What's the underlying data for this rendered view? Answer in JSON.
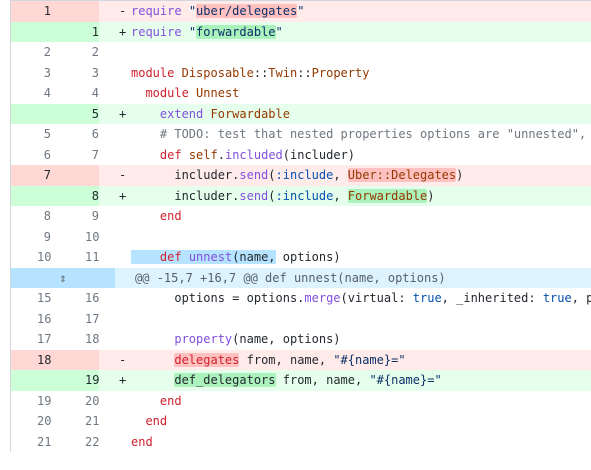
{
  "rows": [
    {
      "type": "del",
      "old": "1",
      "new": "",
      "mark": "-",
      "tokens": [
        [
          "fn",
          "require"
        ],
        [
          "",
          " "
        ],
        [
          "str",
          "\""
        ],
        [
          "hl-del str",
          "uber/delegates"
        ],
        [
          "str",
          "\""
        ]
      ]
    },
    {
      "type": "add",
      "old": "",
      "new": "1",
      "mark": "+",
      "tokens": [
        [
          "fn",
          "require"
        ],
        [
          "",
          " "
        ],
        [
          "str",
          "\""
        ],
        [
          "hl-add str",
          "forwardable"
        ],
        [
          "str",
          "\""
        ]
      ]
    },
    {
      "type": "ctx",
      "old": "2",
      "new": "2",
      "mark": "",
      "tokens": []
    },
    {
      "type": "ctx",
      "old": "3",
      "new": "3",
      "mark": "",
      "tokens": [
        [
          "kw",
          "module"
        ],
        [
          "",
          " "
        ],
        [
          "const",
          "Disposable"
        ],
        [
          "",
          "::"
        ],
        [
          "const",
          "Twin"
        ],
        [
          "",
          "::"
        ],
        [
          "const",
          "Property"
        ]
      ]
    },
    {
      "type": "ctx",
      "old": "4",
      "new": "4",
      "mark": "",
      "tokens": [
        [
          "",
          "  "
        ],
        [
          "kw",
          "module"
        ],
        [
          "",
          " "
        ],
        [
          "const",
          "Unnest"
        ]
      ]
    },
    {
      "type": "add",
      "old": "",
      "new": "5",
      "mark": "+",
      "tokens": [
        [
          "",
          "    "
        ],
        [
          "fn",
          "extend"
        ],
        [
          "",
          " "
        ],
        [
          "const",
          "Forwardable"
        ]
      ]
    },
    {
      "type": "ctx",
      "old": "5",
      "new": "6",
      "mark": "",
      "tokens": [
        [
          "",
          "    "
        ],
        [
          "cm",
          "# TODO: test that nested properties options are \"unnested\", "
        ]
      ]
    },
    {
      "type": "ctx",
      "old": "6",
      "new": "7",
      "mark": "",
      "tokens": [
        [
          "",
          "    "
        ],
        [
          "kw",
          "def"
        ],
        [
          "",
          " "
        ],
        [
          "const",
          "self"
        ],
        [
          "",
          "."
        ],
        [
          "fn",
          "included"
        ],
        [
          "",
          "(includer)"
        ]
      ]
    },
    {
      "type": "del",
      "old": "7",
      "new": "",
      "mark": "-",
      "tokens": [
        [
          "",
          "      includer."
        ],
        [
          "fn",
          "send"
        ],
        [
          "",
          "("
        ],
        [
          "sym",
          ":include"
        ],
        [
          "",
          ", "
        ],
        [
          "hl-del const",
          "Uber::Delegates"
        ],
        [
          "",
          ")"
        ]
      ]
    },
    {
      "type": "add",
      "old": "",
      "new": "8",
      "mark": "+",
      "tokens": [
        [
          "",
          "      includer."
        ],
        [
          "fn",
          "send"
        ],
        [
          "",
          "("
        ],
        [
          "sym",
          ":include"
        ],
        [
          "",
          ", "
        ],
        [
          "hl-add const",
          "Forwardable"
        ],
        [
          "",
          ")"
        ]
      ]
    },
    {
      "type": "ctx",
      "old": "8",
      "new": "9",
      "mark": "",
      "tokens": [
        [
          "",
          "    "
        ],
        [
          "kw",
          "end"
        ]
      ]
    },
    {
      "type": "ctx",
      "old": "9",
      "new": "10",
      "mark": "",
      "tokens": []
    },
    {
      "type": "ctx",
      "old": "10",
      "new": "11",
      "mark": "",
      "tokens": [
        [
          "sel",
          "    "
        ],
        [
          "sel kw",
          "def"
        ],
        [
          "sel",
          " "
        ],
        [
          "sel fn",
          "unnest"
        ],
        [
          "sel",
          "(name,"
        ],
        [
          "",
          " options)"
        ]
      ]
    },
    {
      "type": "hunk",
      "text": "@@ -15,7 +16,7 @@ def unnest(name, options)"
    },
    {
      "type": "ctx",
      "old": "15",
      "new": "16",
      "mark": "",
      "tokens": [
        [
          "",
          "      options = options."
        ],
        [
          "fn",
          "merge"
        ],
        [
          "",
          "(virtual: "
        ],
        [
          "sym",
          "true"
        ],
        [
          "",
          ", _inherited: "
        ],
        [
          "sym",
          "true"
        ],
        [
          "",
          ", p"
        ]
      ]
    },
    {
      "type": "ctx",
      "old": "16",
      "new": "17",
      "mark": "",
      "tokens": []
    },
    {
      "type": "ctx",
      "old": "17",
      "new": "18",
      "mark": "",
      "tokens": [
        [
          "",
          "      "
        ],
        [
          "fn",
          "property"
        ],
        [
          "",
          "(name, options)"
        ]
      ]
    },
    {
      "type": "del",
      "old": "18",
      "new": "",
      "mark": "-",
      "tokens": [
        [
          "",
          "      "
        ],
        [
          "hl-del kw",
          "delegates"
        ],
        [
          "",
          " from, name, "
        ],
        [
          "str",
          "\"#{name}=\""
        ]
      ]
    },
    {
      "type": "add",
      "old": "",
      "new": "19",
      "mark": "+",
      "tokens": [
        [
          "",
          "      "
        ],
        [
          "hl-add",
          "def_delegators"
        ],
        [
          "",
          " from, name, "
        ],
        [
          "str",
          "\"#{name}=\""
        ]
      ]
    },
    {
      "type": "ctx",
      "old": "19",
      "new": "20",
      "mark": "",
      "tokens": [
        [
          "",
          "    "
        ],
        [
          "kw",
          "end"
        ]
      ]
    },
    {
      "type": "ctx",
      "old": "20",
      "new": "21",
      "mark": "",
      "tokens": [
        [
          "",
          "  "
        ],
        [
          "kw",
          "end"
        ]
      ]
    },
    {
      "type": "ctx",
      "old": "21",
      "new": "22",
      "mark": "",
      "tokens": [
        [
          "kw",
          "end"
        ]
      ]
    }
  ],
  "icons": {
    "expand": "unfold-icon"
  }
}
